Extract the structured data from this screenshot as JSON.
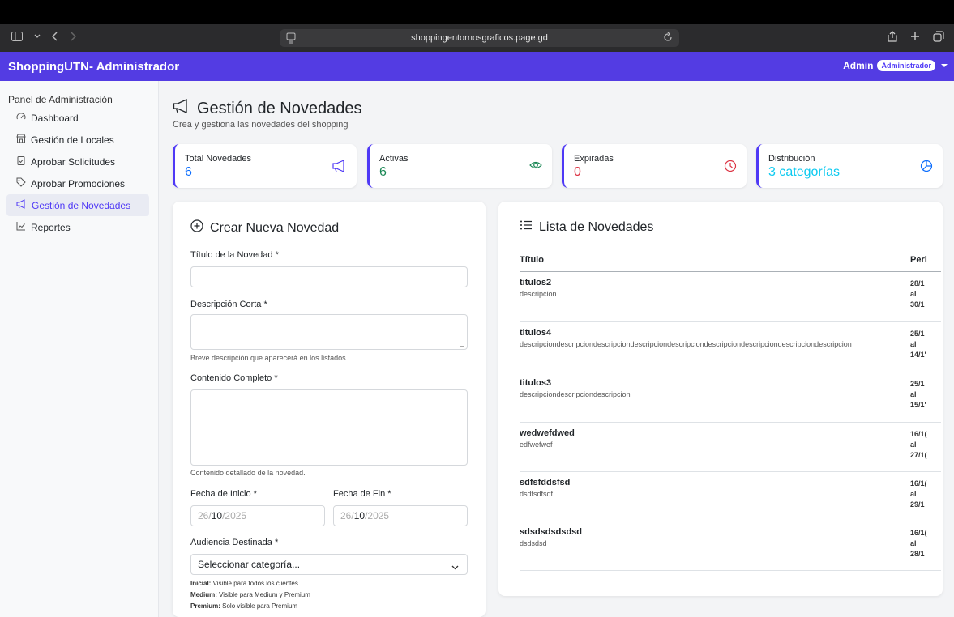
{
  "browser": {
    "url": "shoppingentornosgraficos.page.gd"
  },
  "app": {
    "brand": "ShoppingUTN- Administrador",
    "user_name": "Admin",
    "user_role": "Administrador"
  },
  "sidebar": {
    "title": "Panel de Administración",
    "items": [
      {
        "label": "Dashboard",
        "icon": "gauge-icon"
      },
      {
        "label": "Gestión de Locales",
        "icon": "shop-icon"
      },
      {
        "label": "Aprobar Solicitudes",
        "icon": "clipboard-check-icon"
      },
      {
        "label": "Aprobar Promociones",
        "icon": "tag-icon"
      },
      {
        "label": "Gestión de Novedades",
        "icon": "megaphone-icon",
        "active": true
      },
      {
        "label": "Reportes",
        "icon": "chart-line-icon"
      }
    ]
  },
  "page": {
    "title": "Gestión de Novedades",
    "subtitle": "Crea y gestiona las novedades del shopping"
  },
  "stats": [
    {
      "label": "Total Novedades",
      "value": "6",
      "color": "#0d6efd",
      "icon": "megaphone-icon",
      "border": "#4f39f6"
    },
    {
      "label": "Activas",
      "value": "6",
      "color": "#198754",
      "icon": "eye-icon",
      "border": "#4f39f6"
    },
    {
      "label": "Expiradas",
      "value": "0",
      "color": "#dc3545",
      "icon": "clock-icon",
      "border": "#4f39f6"
    },
    {
      "label": "Distribución",
      "value": "3 categorías",
      "color": "#0dcaf0",
      "icon": "pie-chart-icon",
      "border": "#4f39f6"
    }
  ],
  "form": {
    "title": "Crear Nueva Novedad",
    "titulo_label": "Título de la Novedad *",
    "titulo_value": "",
    "desc_label": "Descripción Corta *",
    "desc_value": "",
    "desc_help": "Breve descripción que aparecerá en los listados.",
    "contenido_label": "Contenido Completo *",
    "contenido_value": "",
    "contenido_help": "Contenido detallado de la novedad.",
    "inicio_label": "Fecha de Inicio *",
    "inicio_day": "26",
    "inicio_month": "10",
    "inicio_year": "2025",
    "fin_label": "Fecha de Fin *",
    "fin_day": "26",
    "fin_month": "10",
    "fin_year": "2025",
    "audiencia_label": "Audiencia Destinada *",
    "audiencia_selected": "Seleccionar categoría...",
    "notes": [
      {
        "key": "Inicial:",
        "text": " Visible para todos los clientes"
      },
      {
        "key": "Medium:",
        "text": " Visible para Medium y Premium"
      },
      {
        "key": "Premium:",
        "text": " Solo visible para Premium"
      }
    ]
  },
  "lista": {
    "title": "Lista de Novedades",
    "col_titulo": "Título",
    "col_periodo": "Peri",
    "rows": [
      {
        "titulo": "titulos2",
        "desc": "descripcion",
        "per1": "28/1",
        "per2": "al",
        "per3": "30/1"
      },
      {
        "titulo": "titulos4",
        "desc": "descripciondescripciondescripciondescripciondescripciondescripciondescripciondescripciondescripcion",
        "per1": "25/1",
        "per2": "al",
        "per3": "14/1'"
      },
      {
        "titulo": "titulos3",
        "desc": "descripciondescripciondescripcion",
        "per1": "25/1",
        "per2": "al",
        "per3": "15/1'"
      },
      {
        "titulo": "wedwefdwed",
        "desc": "edfwefwef",
        "per1": "16/1(",
        "per2": "al",
        "per3": "27/1("
      },
      {
        "titulo": "sdfsfddsfsd",
        "desc": "dsdfsdfsdf",
        "per1": "16/1(",
        "per2": "al",
        "per3": "29/1"
      },
      {
        "titulo": "sdsdsdsdsdsd",
        "desc": "dsdsdsd",
        "per1": "16/1(",
        "per2": "al",
        "per3": "28/1"
      }
    ]
  }
}
